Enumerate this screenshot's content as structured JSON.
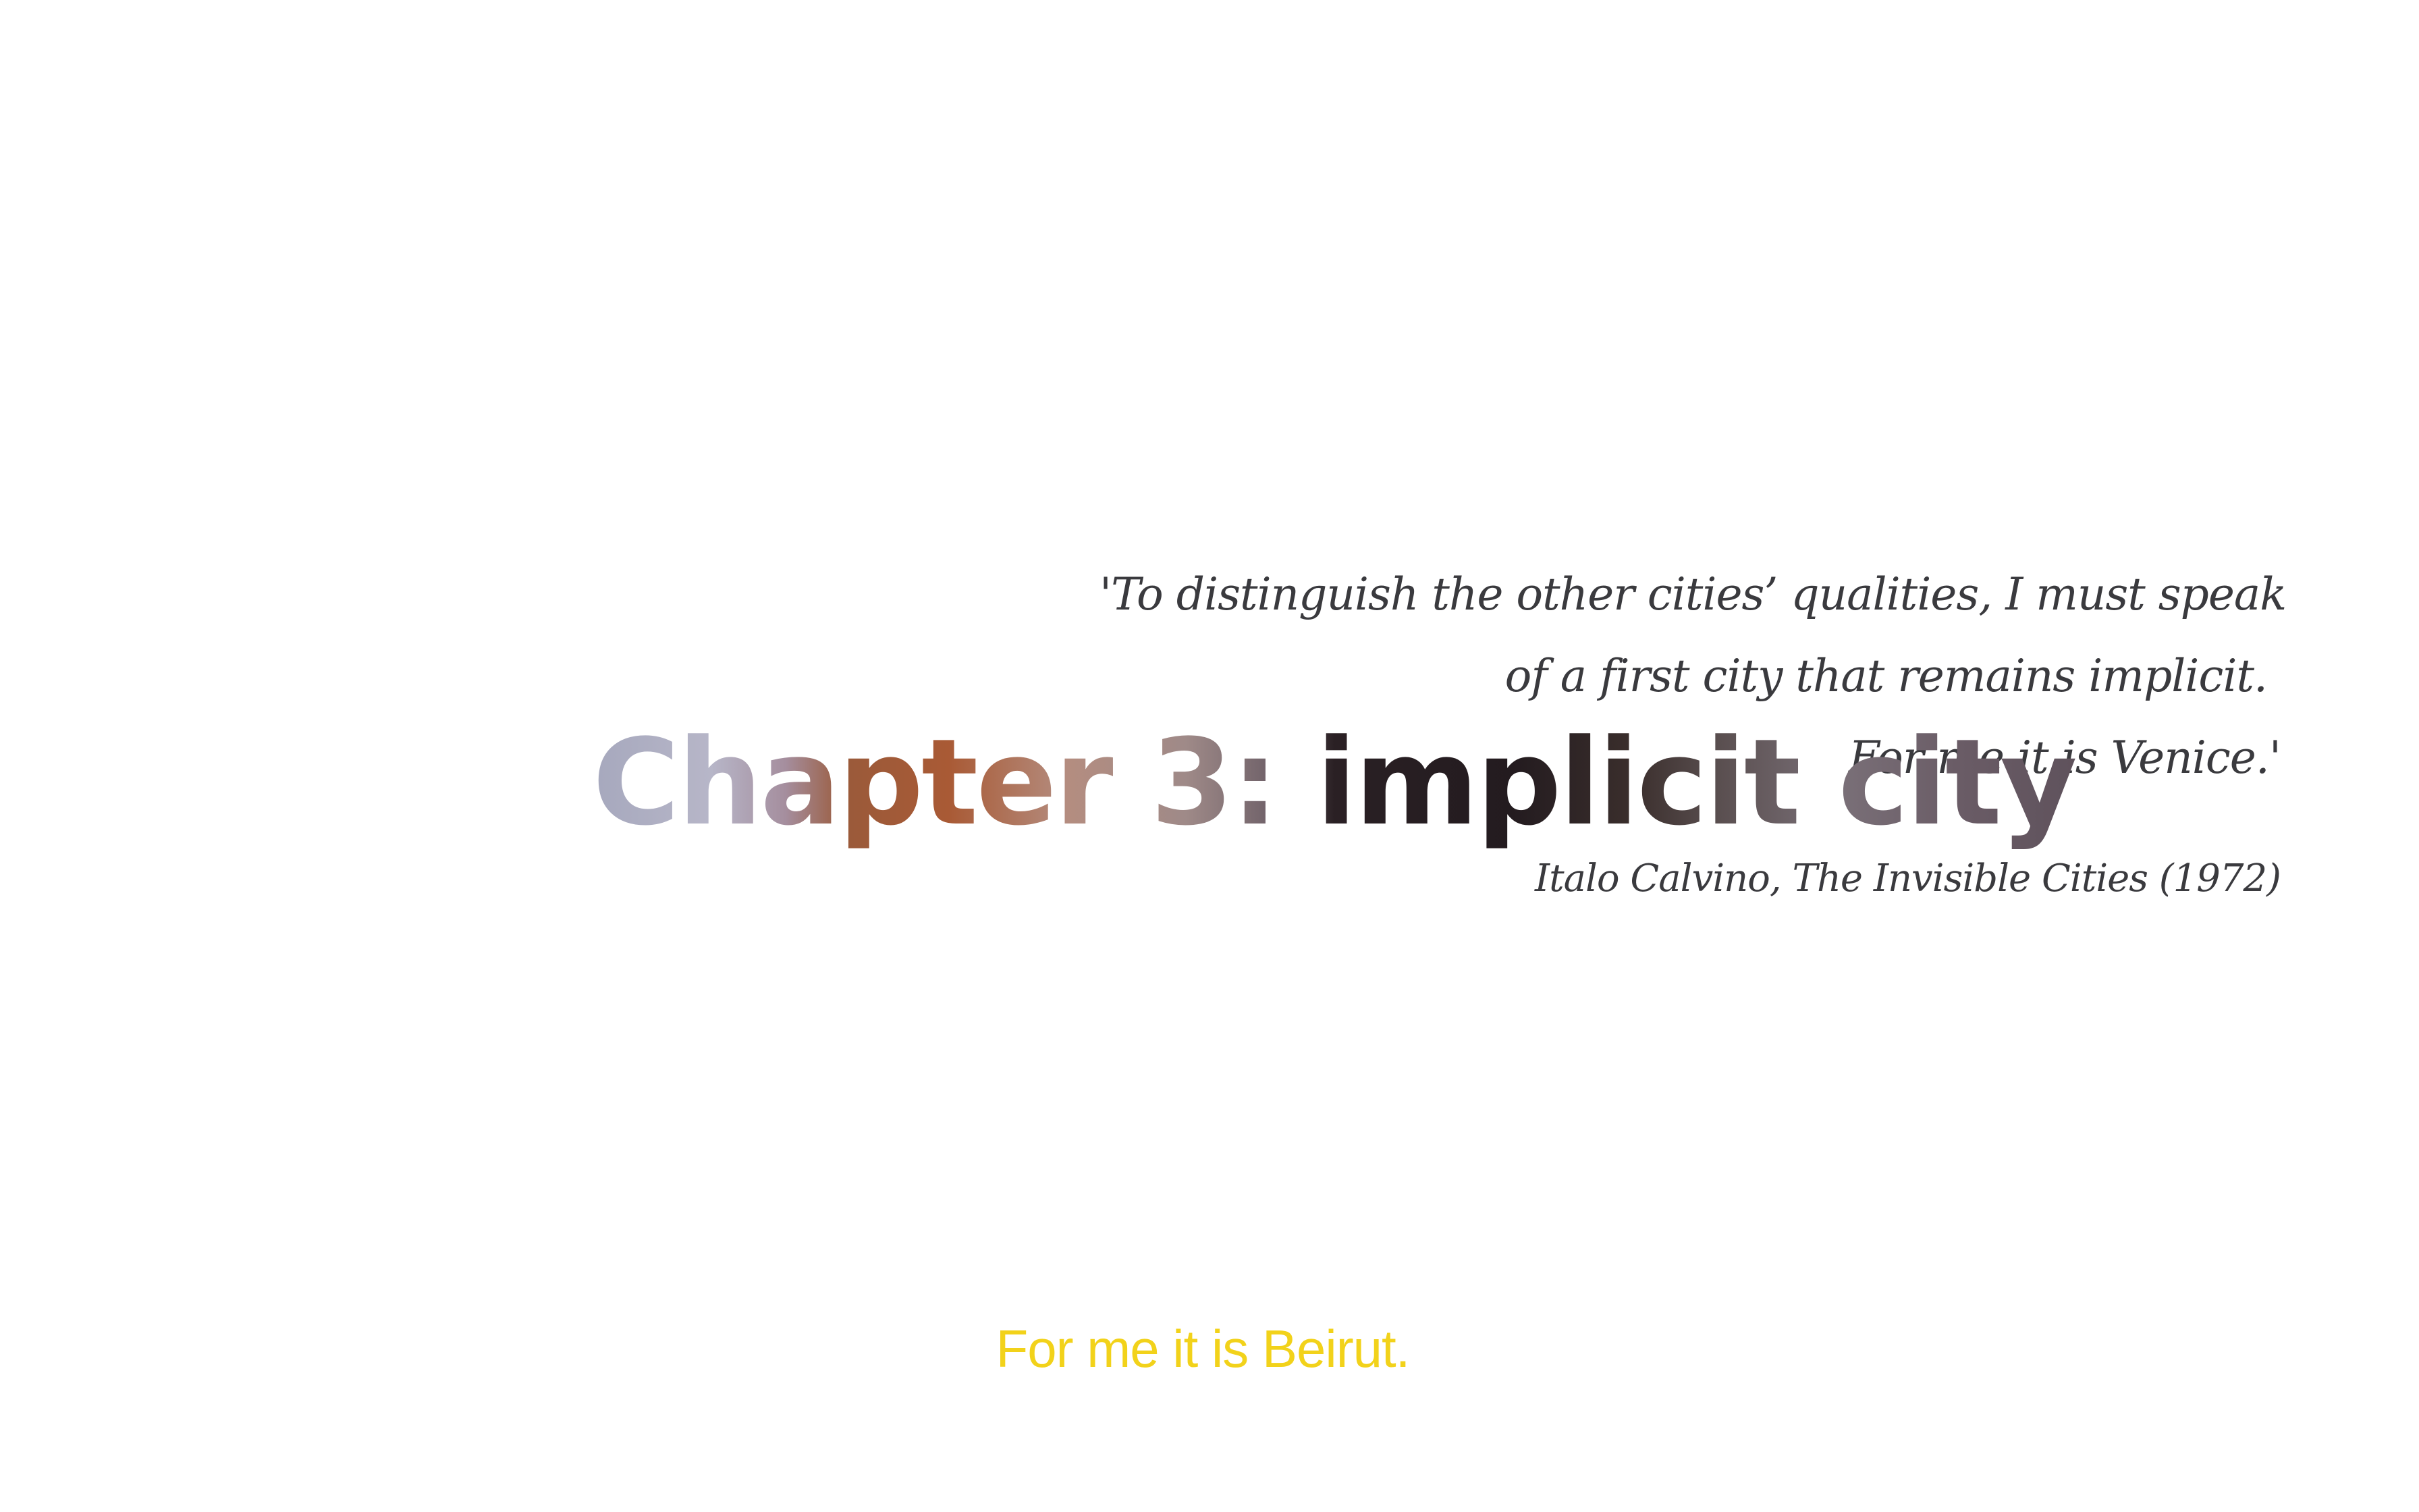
{
  "quote": {
    "lines": [
      "'To distinguish the other cities’ qualities, I must speak",
      "of a first city that remains implicit.",
      "For me it is Venice.'"
    ],
    "attribution": "Italo Calvino, The Invisible Cities (1972)"
  },
  "chapter": {
    "title": "Chapter 3: implicit city"
  },
  "footer": {
    "text": "For me it is Beirut.",
    "color": "#f2d21a"
  }
}
